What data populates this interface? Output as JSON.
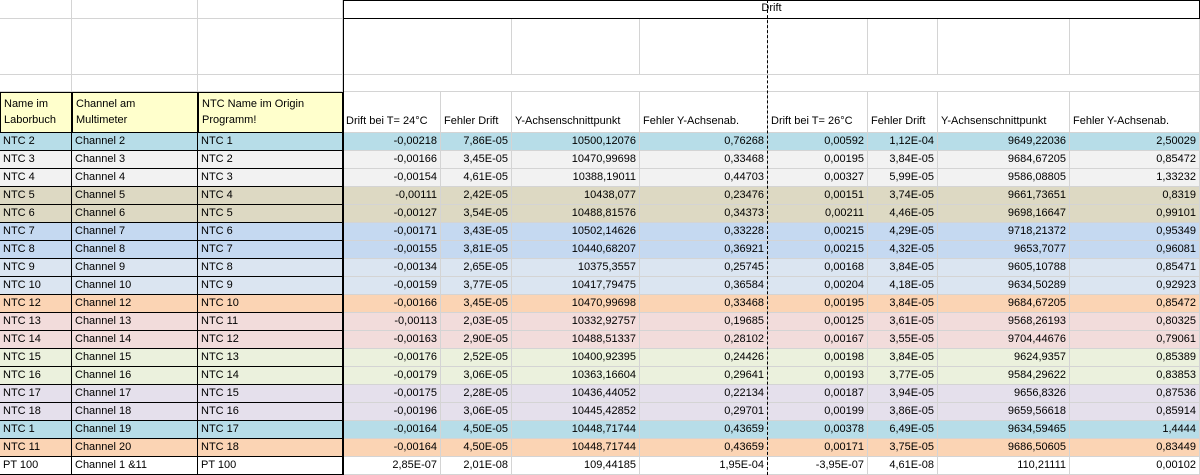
{
  "sheet": {
    "group_header": "Drift",
    "header": {
      "col1": [
        "Name im",
        "Laborbuch"
      ],
      "col2": [
        "Channel am",
        "Multimeter"
      ],
      "col3": [
        "NTC Name im Origin",
        "Programm!"
      ],
      "drift24": "Drift bei T= 24°C",
      "fehler_drift1": "Fehler Drift",
      "yachsen1": "Y-Achsenschnittpunkt",
      "fehler_y1": "Fehler Y-Achsenab.",
      "drift26": "Drift bei T= 26°C",
      "fehler_drift2": "Fehler Drift",
      "yachsen2": "Y-Achsenschnittpunkt",
      "fehler_y2": "Fehler Y-Achsenab."
    },
    "colors": {
      "blue": "#b7dde8",
      "gray": "#f2f2f2",
      "tan": "#ddd9c3",
      "lightblue": "#c5d9f1",
      "paleblue": "#dbe5f1",
      "orange": "#fbd4b4",
      "pink": "#f2dcdb",
      "green": "#ebf1dd",
      "lavender": "#e5e0ec",
      "white": "#ffffff"
    },
    "rows": [
      {
        "color": "blue",
        "cells": [
          "NTC 2",
          "Channel 2",
          "NTC 1",
          "-0,00218",
          "7,86E-05",
          "10500,12076",
          "0,76268",
          "0,00592",
          "1,12E-04",
          "9649,22036",
          "2,50029"
        ]
      },
      {
        "color": "gray",
        "cells": [
          "NTC 3",
          "Channel 3",
          "NTC 2",
          "-0,00166",
          "3,45E-05",
          "10470,99698",
          "0,33468",
          "0,00195",
          "3,84E-05",
          "9684,67205",
          "0,85472"
        ]
      },
      {
        "color": "gray",
        "cells": [
          "NTC 4",
          "Channel 4",
          "NTC 3",
          "-0,00154",
          "4,61E-05",
          "10388,19011",
          "0,44703",
          "0,00327",
          "5,99E-05",
          "9586,08805",
          "1,33232"
        ]
      },
      {
        "color": "tan",
        "cells": [
          "NTC 5",
          "Channel 5",
          "NTC 4",
          "-0,00111",
          "2,42E-05",
          "10438,077",
          "0,23476",
          "0,00151",
          "3,74E-05",
          "9661,73651",
          "0,8319"
        ]
      },
      {
        "color": "tan",
        "cells": [
          "NTC 6",
          "Channel 6",
          "NTC 5",
          "-0,00127",
          "3,54E-05",
          "10488,81576",
          "0,34373",
          "0,00211",
          "4,46E-05",
          "9698,16647",
          "0,99101"
        ]
      },
      {
        "color": "lightblue",
        "cells": [
          "NTC 7",
          "Channel 7",
          "NTC 6",
          "-0,00171",
          "3,43E-05",
          "10502,14626",
          "0,33228",
          "0,00215",
          "4,29E-05",
          "9718,21372",
          "0,95349"
        ]
      },
      {
        "color": "lightblue",
        "cells": [
          "NTC 8",
          "Channel 8",
          "NTC 7",
          "-0,00155",
          "3,81E-05",
          "10440,68207",
          "0,36921",
          "0,00215",
          "4,32E-05",
          "9653,7077",
          "0,96081"
        ]
      },
      {
        "color": "paleblue",
        "cells": [
          "NTC 9",
          "Channel 9",
          "NTC 8",
          "-0,00134",
          "2,65E-05",
          "10375,3557",
          "0,25745",
          "0,00168",
          "3,84E-05",
          "9605,10788",
          "0,85471"
        ]
      },
      {
        "color": "paleblue",
        "cells": [
          "NTC 10",
          "Channel 10",
          "NTC 9",
          "-0,00159",
          "3,77E-05",
          "10417,79475",
          "0,36584",
          "0,00204",
          "4,18E-05",
          "9634,50289",
          "0,92923"
        ]
      },
      {
        "color": "orange",
        "cells": [
          "NTC 12",
          "Channel 12",
          "NTC 10",
          "-0,00166",
          "3,45E-05",
          "10470,99698",
          "0,33468",
          "0,00195",
          "3,84E-05",
          "9684,67205",
          "0,85472"
        ]
      },
      {
        "color": "pink",
        "cells": [
          "NTC 13",
          "Channel 13",
          "NTC 11",
          "-0,00113",
          "2,03E-05",
          "10332,92757",
          "0,19685",
          "0,00125",
          "3,61E-05",
          "9568,26193",
          "0,80325"
        ]
      },
      {
        "color": "pink",
        "cells": [
          "NTC 14",
          "Channel 14",
          "NTC 12",
          "-0,00163",
          "2,90E-05",
          "10488,51337",
          "0,28102",
          "0,00167",
          "3,55E-05",
          "9704,44676",
          "0,79061"
        ]
      },
      {
        "color": "green",
        "cells": [
          "NTC 15",
          "Channel 15",
          "NTC 13",
          "-0,00176",
          "2,52E-05",
          "10400,92395",
          "0,24426",
          "0,00198",
          "3,84E-05",
          "9624,9357",
          "0,85389"
        ]
      },
      {
        "color": "green",
        "cells": [
          "NTC 16",
          "Channel 16",
          "NTC 14",
          "-0,00179",
          "3,06E-05",
          "10363,16604",
          "0,29641",
          "0,00193",
          "3,77E-05",
          "9584,29622",
          "0,83853"
        ]
      },
      {
        "color": "lavender",
        "cells": [
          "NTC 17",
          "Channel 17",
          "NTC 15",
          "-0,00175",
          "2,28E-05",
          "10436,44052",
          "0,22134",
          "0,00187",
          "3,94E-05",
          "9656,8326",
          "0,87536"
        ]
      },
      {
        "color": "lavender",
        "cells": [
          "NTC 18",
          "Channel 18",
          "NTC 16",
          "-0,00196",
          "3,06E-05",
          "10445,42852",
          "0,29701",
          "0,00199",
          "3,86E-05",
          "9659,56618",
          "0,85914"
        ]
      },
      {
        "color": "blue",
        "cells": [
          "NTC 1",
          "Channel 19",
          "NTC 17",
          "-0,00164",
          "4,50E-05",
          "10448,71744",
          "0,43659",
          "0,00378",
          "6,49E-05",
          "9634,59465",
          "1,4444"
        ]
      },
      {
        "color": "orange",
        "cells": [
          "NTC 11",
          "Channel 20",
          "NTC 18",
          "-0,00164",
          "4,50E-05",
          "10448,71744",
          "0,43659",
          "0,00171",
          "3,75E-05",
          "9686,50605",
          "0,83449"
        ]
      },
      {
        "color": "white",
        "cells": [
          "PT 100",
          "Channel 1 &11",
          "PT 100",
          "2,85E-07",
          "2,01E-08",
          "109,44185",
          "1,95E-04",
          "-3,95E-07",
          "4,61E-08",
          "110,21111",
          "0,00102"
        ]
      }
    ]
  }
}
